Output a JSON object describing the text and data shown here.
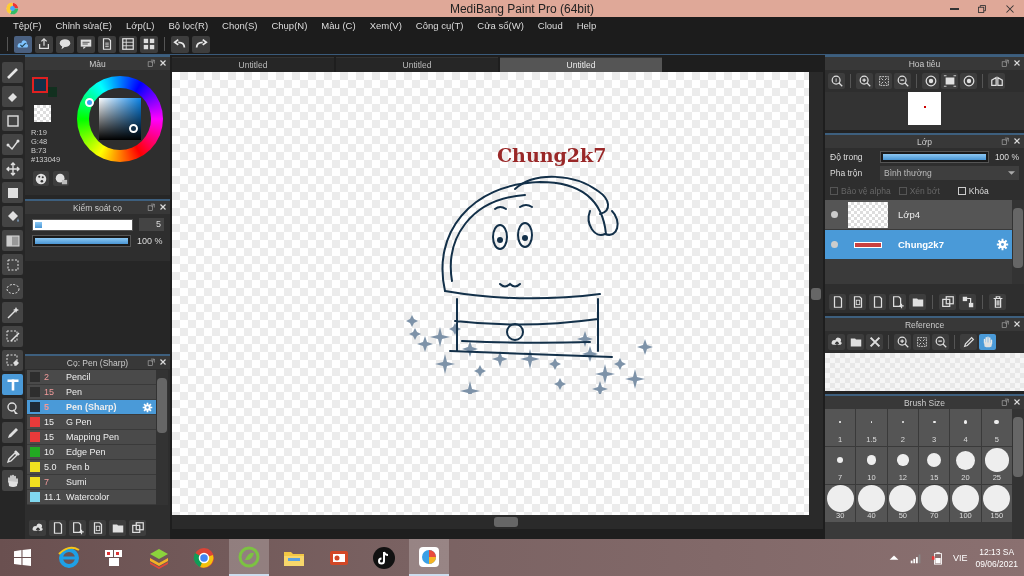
{
  "window": {
    "title": "MediBang Paint Pro (64bit)"
  },
  "menu": [
    "Tệp(F)",
    "Chỉnh sửa(E)",
    "Lớp(L)",
    "Bộ lọc(R)",
    "Chọn(S)",
    "Chụp(N)",
    "Màu (C)",
    "Xem(V)",
    "Công cụ(T)",
    "Cửa sổ(W)",
    "Cloud",
    "Help"
  ],
  "tools": [
    {
      "kind": "brush",
      "selected": false
    },
    {
      "kind": "eraser",
      "selected": false
    },
    {
      "kind": "rect",
      "selected": false
    },
    {
      "kind": "dotline",
      "selected": false
    },
    {
      "kind": "move",
      "selected": false
    },
    {
      "kind": "fillrect",
      "selected": false
    },
    {
      "kind": "bucket",
      "selected": false
    },
    {
      "kind": "gradient",
      "selected": false
    },
    {
      "kind": "selrect",
      "selected": false
    },
    {
      "kind": "lasso",
      "selected": false
    },
    {
      "kind": "wand",
      "selected": false
    },
    {
      "kind": "selpen",
      "selected": false
    },
    {
      "kind": "selerase",
      "selected": false
    },
    {
      "kind": "text",
      "selected": true
    },
    {
      "kind": "pointer",
      "selected": false
    },
    {
      "kind": "blur",
      "selected": false
    },
    {
      "kind": "dropper",
      "selected": false
    },
    {
      "kind": "hand",
      "selected": false
    }
  ],
  "color_panel": {
    "title": "Màu",
    "swatches": [
      {
        "kind": "primary",
        "color": "#133049"
      },
      {
        "kind": "secondary",
        "color": "#12301f"
      }
    ],
    "readout": [
      "R:19",
      "G:48",
      "B:73",
      "#133049"
    ]
  },
  "brush_control": {
    "title": "Kiểm soát cọ",
    "size": {
      "level": 0.07,
      "value": "5"
    },
    "opacity": {
      "level": 1,
      "reading": "100 %"
    }
  },
  "brush_panel": {
    "title": "Cọ: Pen (Sharp)",
    "brushes": [
      {
        "size": "2",
        "name": "Pencil",
        "color": "#2e2e2e",
        "marked": true,
        "selected": false
      },
      {
        "size": "15",
        "name": "Pen",
        "color": "#2e2e2e",
        "marked": true,
        "selected": false
      },
      {
        "size": "5",
        "name": "Pen (Sharp)",
        "color": "#1e2a38",
        "marked": true,
        "selected": true
      },
      {
        "size": "15",
        "name": "G Pen",
        "color": "#e83a3a",
        "marked": false,
        "selected": false
      },
      {
        "size": "15",
        "name": "Mapping Pen",
        "color": "#e83a3a",
        "marked": false,
        "selected": false
      },
      {
        "size": "10",
        "name": "Edge Pen",
        "color": "#22aa22",
        "marked": false,
        "selected": false
      },
      {
        "size": "5.0",
        "name": "Pen b",
        "color": "#f0e020",
        "marked": false,
        "selected": false
      },
      {
        "size": "7",
        "name": "Sumi",
        "color": "#f0e020",
        "marked": true,
        "selected": false
      },
      {
        "size": "11.1",
        "name": "Watercolor",
        "color": "#80d8f0",
        "marked": false,
        "selected": false
      }
    ]
  },
  "canvas": {
    "tabs": [
      {
        "label": "Untitled",
        "selected": false
      },
      {
        "label": "Untitled",
        "selected": false
      },
      {
        "label": "Untitled",
        "selected": true
      }
    ],
    "text": "Chung2k7"
  },
  "navigator": {
    "title": "Hoa tiêu"
  },
  "layers_panel": {
    "title": "Lớp",
    "opacity": {
      "label": "Độ trong",
      "level": 1,
      "reading": "100 %"
    },
    "blend": {
      "label": "Pha trộn",
      "value": "Bình thường"
    },
    "options": [
      {
        "label": "Bảo vệ alpha",
        "checked": false,
        "disabled": true
      },
      {
        "label": "Xén bớt",
        "checked": false,
        "disabled": true
      },
      {
        "label": "Khóa",
        "checked": false,
        "disabled": false
      }
    ],
    "layers": [
      {
        "name": "Lớp4",
        "selected": false,
        "visible": true
      },
      {
        "name": "Chung2k7",
        "selected": true,
        "visible": true
      }
    ]
  },
  "reference": {
    "title": "Reference"
  },
  "brush_size": {
    "title": "Brush Size",
    "sizes": [
      "1",
      "1.5",
      "2",
      "3",
      "4",
      "5",
      "7",
      "10",
      "12",
      "15",
      "20",
      "25",
      "30",
      "40",
      "50",
      "70",
      "100",
      "150"
    ]
  },
  "taskbar": {
    "apps": [
      {
        "kind": "ie",
        "active": false
      },
      {
        "kind": "app",
        "active": false
      },
      {
        "kind": "stack",
        "active": false
      },
      {
        "kind": "chrome",
        "active": false
      },
      {
        "kind": "coccoc",
        "active": true
      },
      {
        "kind": "folder",
        "active": false
      },
      {
        "kind": "slides",
        "active": false
      },
      {
        "kind": "tiktok",
        "active": false
      },
      {
        "kind": "medibang",
        "active": true
      }
    ],
    "language": "VIE",
    "time": "12:13 SA",
    "date": "09/06/2021"
  }
}
